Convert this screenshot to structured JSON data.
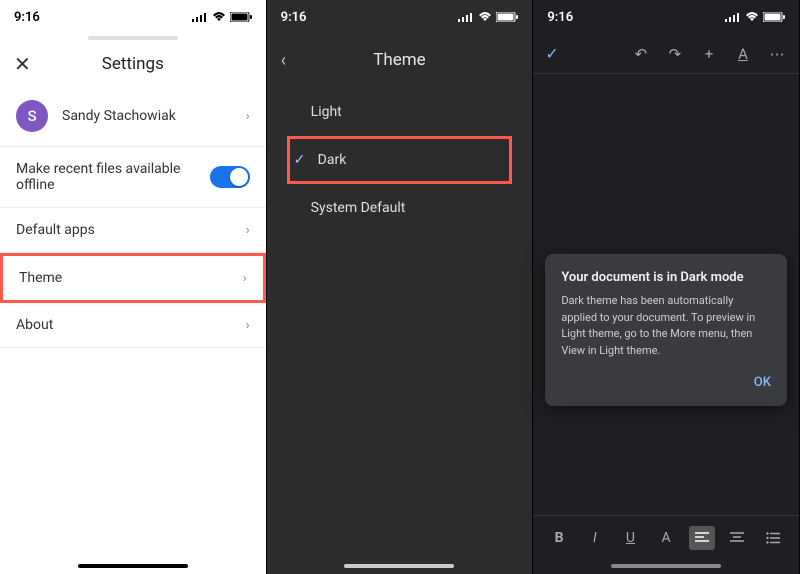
{
  "status": {
    "time": "9:16"
  },
  "screen1": {
    "title": "Settings",
    "account": {
      "initial": "S",
      "name": "Sandy Stachowiak"
    },
    "offline_label": "Make recent files available offline",
    "rows": {
      "default_apps": "Default apps",
      "theme": "Theme",
      "about": "About"
    }
  },
  "screen2": {
    "title": "Theme",
    "options": {
      "light": "Light",
      "dark": "Dark",
      "system": "System Default"
    }
  },
  "screen3": {
    "dialog": {
      "title": "Your document is in Dark mode",
      "body": "Dark theme has been automatically applied to your document. To preview in Light theme, go to the More menu, then View in Light theme.",
      "ok": "OK"
    },
    "format": {
      "bold": "B",
      "italic": "I",
      "underline": "U",
      "text": "A"
    }
  }
}
